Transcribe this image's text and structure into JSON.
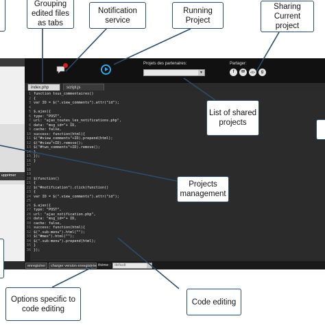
{
  "callouts": {
    "tabs": "Grouping edited files as tabs",
    "notification": "Notification service",
    "running": "Running Project",
    "sharing": "Sharing Current project",
    "shared_list": "List of shared projects",
    "projects": "Projects management",
    "options": "Options specific to code editing",
    "code": "Code editing"
  },
  "toolbar": {
    "partners_label": "Projets des partenaires:",
    "share_label": "Partager:",
    "share_icons": [
      "f",
      "✉",
      "</>",
      "g"
    ]
  },
  "tabs": [
    {
      "label": "index.php"
    },
    {
      "label": "script.js"
    }
  ],
  "left_panel": {
    "delete_label": "Supprimer"
  },
  "code_lines": [
    "function tous_commentaires()",
    "{",
    "var ID = $(\".view_comments\").attr(\"id\");",
    "",
    "$.ajax({",
    "type: \"POST\",",
    "url: \"ajax_toutes_les_notifications.php\",",
    "data: \"msg_id=\"+ ID,",
    "cache: false,",
    "success: function(html){",
    "$(\"#view_comments\"+ID).prepend(html);",
    "$(\"#view\"+ID).remove();",
    "$(\"#two_comments\"+ID).remove();",
    "}",
    "});",
    "}",
    "",
    "",
    "",
    "$(function()",
    "{",
    "$(\"#notification\").click(function()",
    "{",
    "var ID = $(\".view_comments\").attr(\"id\");",
    "",
    "$.ajax({",
    "type: \"POST\",",
    "url: \"ajax_notification.php\",",
    "data: \"msg_id=\"+ ID,",
    "cache: false,",
    "success: function(html){",
    "$(\".sub-menu\").html(\"\");",
    "$(\"#mes\").html(\"\");",
    "$(\".sub-menu\").prepend(html);",
    "}",
    "});"
  ],
  "bottom_bar": {
    "save_label": "enregistrer",
    "load_label": "charger version enregistrée",
    "theme_label": "thème :",
    "theme_value": "default"
  },
  "colors": {
    "ide_background": "#1c1c1c",
    "callout_border": "#2d4b6a",
    "run_button": "#37a7e8",
    "notification_badge": "#d42020"
  }
}
